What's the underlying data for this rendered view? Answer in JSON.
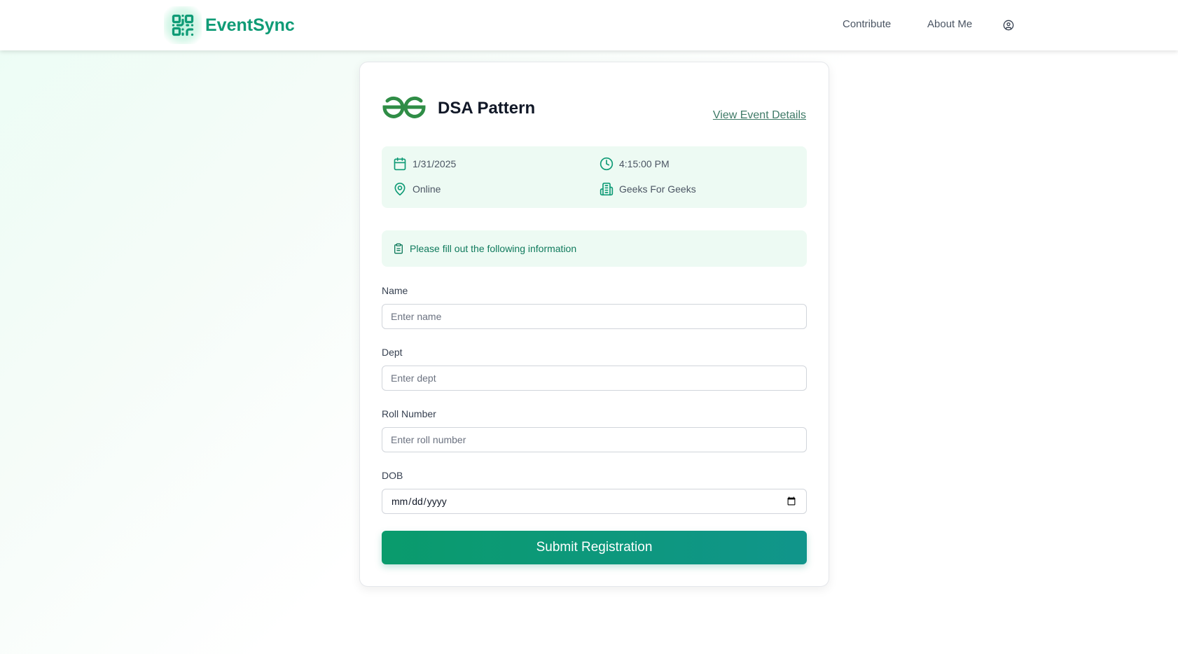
{
  "header": {
    "brand_name": "EventSync",
    "nav": {
      "contribute": "Contribute",
      "about": "About Me"
    },
    "icons": {
      "brand": "qr-code-icon",
      "user": "user-circle-icon"
    }
  },
  "event": {
    "title": "DSA Pattern",
    "view_details_label": "View Event Details",
    "date": "1/31/2025",
    "time": "4:15:00 PM",
    "location": "Online",
    "organizer": "Geeks For Geeks",
    "logo": "geeksforgeeks-logo"
  },
  "form": {
    "notice": "Please fill out the following information",
    "fields": {
      "name": {
        "label": "Name",
        "placeholder": "Enter name",
        "value": ""
      },
      "dept": {
        "label": "Dept",
        "placeholder": "Enter dept",
        "value": ""
      },
      "roll": {
        "label": "Roll Number",
        "placeholder": "Enter roll number",
        "value": ""
      },
      "dob": {
        "label": "DOB",
        "placeholder": "mm/dd/yyyy",
        "value": ""
      }
    },
    "submit_label": "Submit Registration"
  },
  "colors": {
    "brand": "#0f9b76",
    "accent_bg": "#edfaf3",
    "button_start": "#0a9b6c",
    "button_end": "#10958b",
    "gfg_green": "#2f8d46"
  }
}
